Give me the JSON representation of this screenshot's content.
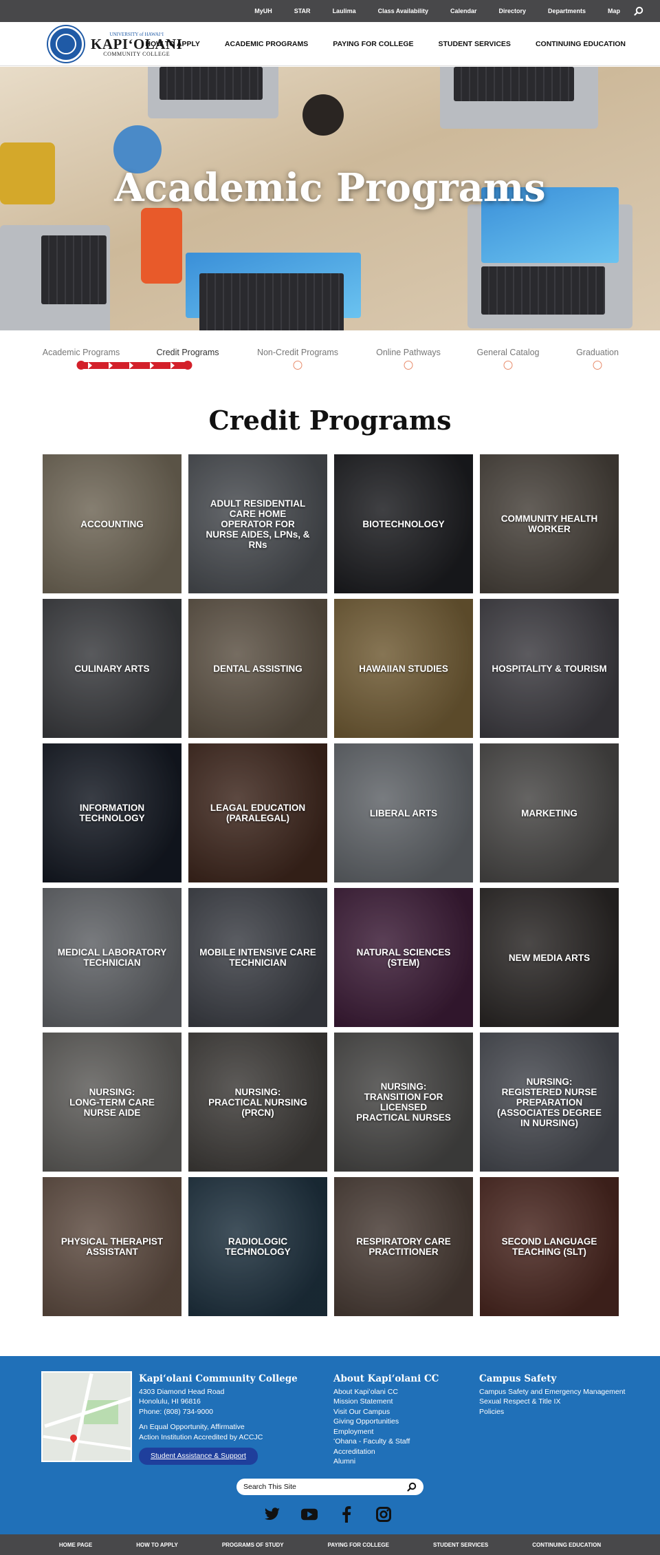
{
  "topbar": {
    "links": [
      "MyUH",
      "STAR",
      "Laulima",
      "Class Availability",
      "Calendar",
      "Directory",
      "Departments",
      "Map"
    ],
    "search_icon": "search-icon"
  },
  "header": {
    "logo": {
      "line1": "UNIVERSITY of HAWAIʻI",
      "line2": "KAPIʻOLANI",
      "line3": "COMMUNITY COLLEGE"
    },
    "nav": [
      "HOW TO APPLY",
      "ACADEMIC PROGRAMS",
      "PAYING FOR COLLEGE",
      "STUDENT SERVICES",
      "CONTINUING EDUCATION"
    ]
  },
  "hero": {
    "title": "Academic Programs"
  },
  "steps": {
    "items": [
      "Academic Programs",
      "Credit Programs",
      "Non-Credit Programs",
      "Online Pathways",
      "General Catalog",
      "Graduation"
    ],
    "current": 1,
    "accent": "#d3202a"
  },
  "section": {
    "title": "Credit Programs"
  },
  "programs": [
    {
      "label": "ACCOUNTING",
      "color": "#a79a82"
    },
    {
      "label": "ADULT RESIDENTIAL\nCARE HOME\nOPERATOR FOR\nNURSE AIDES, LPNs, & RNs",
      "color": "#6d7279"
    },
    {
      "label": "BIOTECHNOLOGY",
      "color": "#2a2b30"
    },
    {
      "label": "COMMUNITY HEALTH\nWORKER",
      "color": "#6b6258"
    },
    {
      "label": "CULINARY ARTS",
      "color": "#57595e"
    },
    {
      "label": "DENTAL ASSISTING",
      "color": "#8a7a66"
    },
    {
      "label": "HAWAIIAN STUDIES",
      "color": "#a8894f"
    },
    {
      "label": "HOSPITALITY & TOURISM",
      "color": "#5c5a62"
    },
    {
      "label": "INFORMATION\nTECHNOLOGY",
      "color": "#1f2634"
    },
    {
      "label": "LEAGAL EDUCATION\n(PARALEGAL)",
      "color": "#5d3a2c"
    },
    {
      "label": "LIBERAL ARTS",
      "color": "#8f959c"
    },
    {
      "label": "MARKETING",
      "color": "#6c6a68"
    },
    {
      "label": "MEDICAL LABORATORY\nTECHNICIAN",
      "color": "#8f9399"
    },
    {
      "label": "MOBILE INTENSIVE CARE\nTECHNICIAN",
      "color": "#5a5e68"
    },
    {
      "label": "NATURAL SCIENCES\n(STEM)",
      "color": "#5a2a52"
    },
    {
      "label": "NEW MEDIA ARTS",
      "color": "#3f3a38"
    },
    {
      "label": "NURSING:\nLONG-TERM CARE\nNURSE AIDE",
      "color": "#8c8a86"
    },
    {
      "label": "NURSING:\nPRACTICAL NURSING (PRCN)",
      "color": "#5e5a56"
    },
    {
      "label": "NURSING:\nTRANSITION FOR LICENSED\nPRACTICAL NURSES",
      "color": "#6b6a68"
    },
    {
      "label": "NURSING:\nREGISTERED NURSE\nPREPARATION\n(ASSOCIATES DEGREE\nIN NURSING)",
      "color": "#6a6e78"
    },
    {
      "label": "PHYSICAL THERAPIST\nASSISTANT",
      "color": "#8d7262"
    },
    {
      "label": "RADIOLOGIC TECHNOLOGY",
      "color": "#2e4a5e"
    },
    {
      "label": "RESPIRATORY CARE\nPRACTITIONER",
      "color": "#6d5a50"
    },
    {
      "label": "SECOND LANGUAGE\nTEACHING (SLT)",
      "color": "#6e3a30"
    }
  ],
  "footer": {
    "bg": "#2070b8",
    "college": {
      "name": "Kapiʻolani Community College",
      "address1": "4303 Diamond Head Road",
      "address2": "Honolulu, HI 96816",
      "phone": "Phone: (808) 734-9000",
      "note1": "An Equal Opportunity, Affirmative",
      "note2": "Action Institution Accredited by ACCJC",
      "button": "Student Assistance & Support"
    },
    "about": {
      "title": "About Kapiʻolani CC",
      "links": [
        "About Kapiʻolani CC",
        "Mission Statement",
        "Visit Our Campus",
        "Giving Opportunities",
        "Employment",
        "ʻOhana - Faculty & Staff",
        "Accreditation",
        "Alumni"
      ]
    },
    "safety": {
      "title": "Campus Safety",
      "links": [
        "Campus Safety and Emergency Management",
        "Sexual Respect & Title IX",
        "Policies"
      ]
    },
    "search_placeholder": "Search This Site",
    "social": [
      "twitter-icon",
      "youtube-icon",
      "facebook-icon",
      "instagram-icon"
    ]
  },
  "bottombar": {
    "links": [
      "HOME PAGE",
      "HOW TO APPLY",
      "PROGRAMS OF STUDY",
      "PAYING FOR COLLEGE",
      "STUDENT SERVICES",
      "CONTINUING EDUCATION"
    ]
  }
}
